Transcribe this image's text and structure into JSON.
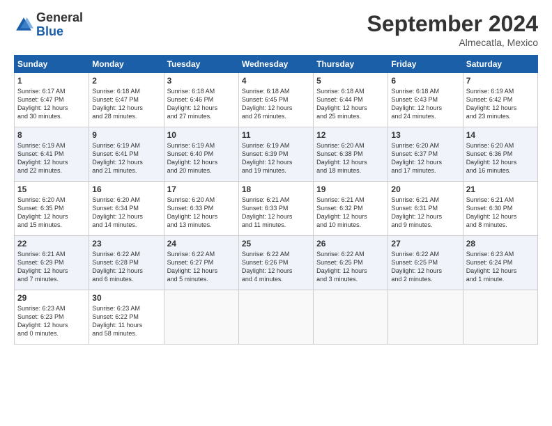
{
  "header": {
    "logo_general": "General",
    "logo_blue": "Blue",
    "month_title": "September 2024",
    "location": "Almecatla, Mexico"
  },
  "weekdays": [
    "Sunday",
    "Monday",
    "Tuesday",
    "Wednesday",
    "Thursday",
    "Friday",
    "Saturday"
  ],
  "rows": [
    [
      {
        "day": "1",
        "info": "Sunrise: 6:17 AM\nSunset: 6:47 PM\nDaylight: 12 hours\nand 30 minutes."
      },
      {
        "day": "2",
        "info": "Sunrise: 6:18 AM\nSunset: 6:47 PM\nDaylight: 12 hours\nand 28 minutes."
      },
      {
        "day": "3",
        "info": "Sunrise: 6:18 AM\nSunset: 6:46 PM\nDaylight: 12 hours\nand 27 minutes."
      },
      {
        "day": "4",
        "info": "Sunrise: 6:18 AM\nSunset: 6:45 PM\nDaylight: 12 hours\nand 26 minutes."
      },
      {
        "day": "5",
        "info": "Sunrise: 6:18 AM\nSunset: 6:44 PM\nDaylight: 12 hours\nand 25 minutes."
      },
      {
        "day": "6",
        "info": "Sunrise: 6:18 AM\nSunset: 6:43 PM\nDaylight: 12 hours\nand 24 minutes."
      },
      {
        "day": "7",
        "info": "Sunrise: 6:19 AM\nSunset: 6:42 PM\nDaylight: 12 hours\nand 23 minutes."
      }
    ],
    [
      {
        "day": "8",
        "info": "Sunrise: 6:19 AM\nSunset: 6:41 PM\nDaylight: 12 hours\nand 22 minutes."
      },
      {
        "day": "9",
        "info": "Sunrise: 6:19 AM\nSunset: 6:41 PM\nDaylight: 12 hours\nand 21 minutes."
      },
      {
        "day": "10",
        "info": "Sunrise: 6:19 AM\nSunset: 6:40 PM\nDaylight: 12 hours\nand 20 minutes."
      },
      {
        "day": "11",
        "info": "Sunrise: 6:19 AM\nSunset: 6:39 PM\nDaylight: 12 hours\nand 19 minutes."
      },
      {
        "day": "12",
        "info": "Sunrise: 6:20 AM\nSunset: 6:38 PM\nDaylight: 12 hours\nand 18 minutes."
      },
      {
        "day": "13",
        "info": "Sunrise: 6:20 AM\nSunset: 6:37 PM\nDaylight: 12 hours\nand 17 minutes."
      },
      {
        "day": "14",
        "info": "Sunrise: 6:20 AM\nSunset: 6:36 PM\nDaylight: 12 hours\nand 16 minutes."
      }
    ],
    [
      {
        "day": "15",
        "info": "Sunrise: 6:20 AM\nSunset: 6:35 PM\nDaylight: 12 hours\nand 15 minutes."
      },
      {
        "day": "16",
        "info": "Sunrise: 6:20 AM\nSunset: 6:34 PM\nDaylight: 12 hours\nand 14 minutes."
      },
      {
        "day": "17",
        "info": "Sunrise: 6:20 AM\nSunset: 6:33 PM\nDaylight: 12 hours\nand 13 minutes."
      },
      {
        "day": "18",
        "info": "Sunrise: 6:21 AM\nSunset: 6:33 PM\nDaylight: 12 hours\nand 11 minutes."
      },
      {
        "day": "19",
        "info": "Sunrise: 6:21 AM\nSunset: 6:32 PM\nDaylight: 12 hours\nand 10 minutes."
      },
      {
        "day": "20",
        "info": "Sunrise: 6:21 AM\nSunset: 6:31 PM\nDaylight: 12 hours\nand 9 minutes."
      },
      {
        "day": "21",
        "info": "Sunrise: 6:21 AM\nSunset: 6:30 PM\nDaylight: 12 hours\nand 8 minutes."
      }
    ],
    [
      {
        "day": "22",
        "info": "Sunrise: 6:21 AM\nSunset: 6:29 PM\nDaylight: 12 hours\nand 7 minutes."
      },
      {
        "day": "23",
        "info": "Sunrise: 6:22 AM\nSunset: 6:28 PM\nDaylight: 12 hours\nand 6 minutes."
      },
      {
        "day": "24",
        "info": "Sunrise: 6:22 AM\nSunset: 6:27 PM\nDaylight: 12 hours\nand 5 minutes."
      },
      {
        "day": "25",
        "info": "Sunrise: 6:22 AM\nSunset: 6:26 PM\nDaylight: 12 hours\nand 4 minutes."
      },
      {
        "day": "26",
        "info": "Sunrise: 6:22 AM\nSunset: 6:25 PM\nDaylight: 12 hours\nand 3 minutes."
      },
      {
        "day": "27",
        "info": "Sunrise: 6:22 AM\nSunset: 6:25 PM\nDaylight: 12 hours\nand 2 minutes."
      },
      {
        "day": "28",
        "info": "Sunrise: 6:23 AM\nSunset: 6:24 PM\nDaylight: 12 hours\nand 1 minute."
      }
    ],
    [
      {
        "day": "29",
        "info": "Sunrise: 6:23 AM\nSunset: 6:23 PM\nDaylight: 12 hours\nand 0 minutes."
      },
      {
        "day": "30",
        "info": "Sunrise: 6:23 AM\nSunset: 6:22 PM\nDaylight: 11 hours\nand 58 minutes."
      },
      null,
      null,
      null,
      null,
      null
    ]
  ]
}
